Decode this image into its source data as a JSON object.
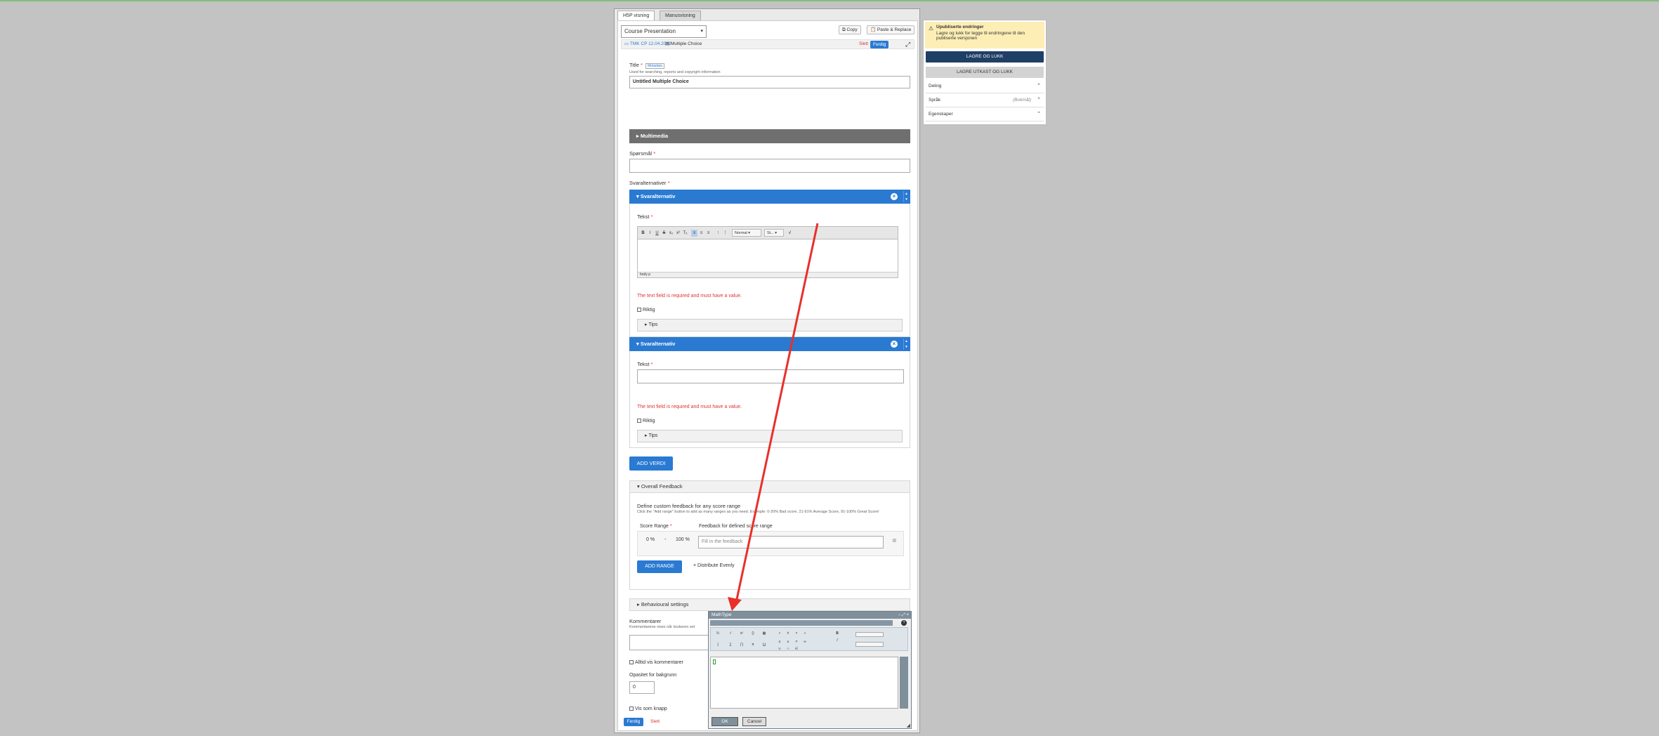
{
  "tabs": [
    "H5P visning",
    "Manusvisning"
  ],
  "content_type_select": "Course Presentation",
  "header_buttons": {
    "copy": "Copy",
    "paste": "Paste & Replace"
  },
  "crumbs": {
    "slide": "TMK CP 12.04.2022",
    "type": "Multiple Choice",
    "delete": "Slett",
    "done": "Ferdig"
  },
  "title_field": {
    "label": "Title",
    "badge": "Metadata",
    "help": "Used for searching, reports and copyright information",
    "value": "Untitled Multiple Choice"
  },
  "multimedia": "Multimedia",
  "question_label": "Spørsmål",
  "answers_label": "Svaralternativer",
  "answer_items": [
    {
      "header": "Svaralternativ",
      "text_label": "Tekst",
      "error": "The text field is required and must have a value.",
      "correct": "Riktig",
      "tips": "Tips"
    },
    {
      "header": "Svaralternativ",
      "text_label": "Tekst",
      "error": "The text field is required and must have a value.",
      "correct": "Riktig",
      "tips": "Tips"
    }
  ],
  "rte": {
    "format": "Normal",
    "style": "St...",
    "path": "body  p"
  },
  "add_value": "ADD VERDI",
  "overall_feedback": {
    "header": "Overall Feedback",
    "title": "Define custom feedback for any score range",
    "desc": "Click the \"Add range\" button to add as many ranges as you need. Example: 0-20% Bad score, 21-91% Average Score, 91-100% Great Score!",
    "score_range_label": "Score Range",
    "feedback_label": "Feedback for defined score range",
    "from": "0 %",
    "to": "100 %",
    "feedback_placeholder": "Fill in the feedback",
    "add_range": "ADD RANGE",
    "distribute": "Distribute Evenly"
  },
  "behavioural": "Behavioural settings",
  "comments": {
    "label": "Kommentarer",
    "help": "Kommentarene vises når brukeren set"
  },
  "always_show": "Alltid vis kommentarer",
  "opacity": {
    "label": "Opasitet for bakgrunn",
    "value": "0"
  },
  "show_as_button": "Vis som knapp",
  "footer": {
    "done": "Ferdig",
    "delete": "Slett"
  },
  "side_panel": {
    "warning_title": "Upubliserte endringer",
    "warning_text": "Lagre og lukk for legge til endringene til den publiserte versjonen",
    "save_close": "LAGRE OG LUKK",
    "save_draft": "LAGRE UTKAST OG LUKK",
    "rows": [
      {
        "label": "Deling",
        "extra": ""
      },
      {
        "label": "Språk",
        "extra": "(Bokmål)"
      },
      {
        "label": "Egenskaper",
        "extra": ""
      }
    ]
  },
  "mathtype": {
    "title": "MathType",
    "ok": "OK",
    "cancel": "Cancel",
    "help": "?"
  },
  "colors": {
    "accent": "#2a7ad2",
    "error": "#d33333",
    "annotation": "#e8302a"
  }
}
